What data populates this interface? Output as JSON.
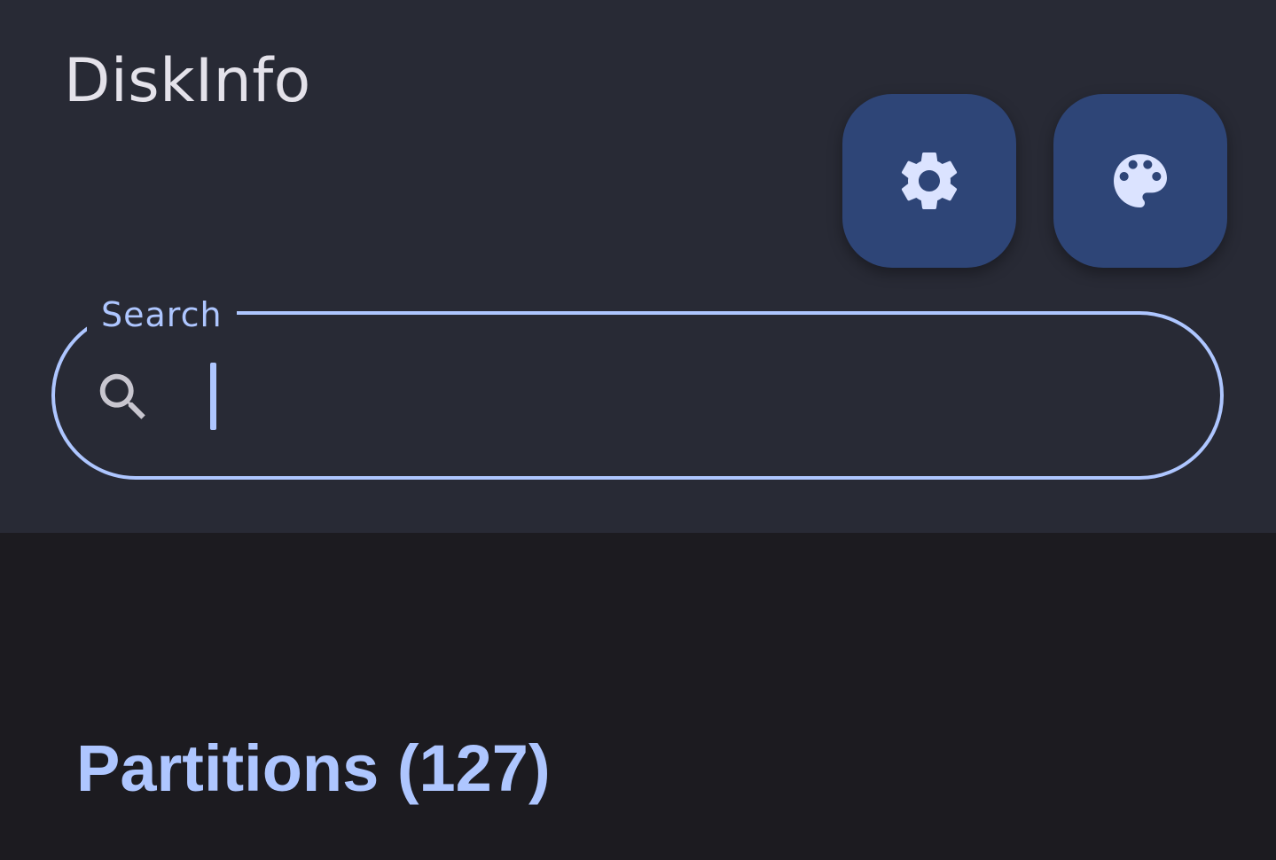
{
  "app": {
    "title": "DiskInfo"
  },
  "toolbar": {
    "settings_icon": "gear-icon",
    "theme_icon": "palette-icon"
  },
  "search": {
    "label": "Search",
    "value": "",
    "placeholder": "",
    "icon": "search-icon"
  },
  "partitions": {
    "title": "Partitions (127)"
  },
  "colors": {
    "accent": "#aec6ff",
    "top_bar": "#282a35",
    "background": "#1c1b20",
    "fab": "#2e4577",
    "icon": "#dbe3ff",
    "title_text": "#e4e2ea"
  }
}
